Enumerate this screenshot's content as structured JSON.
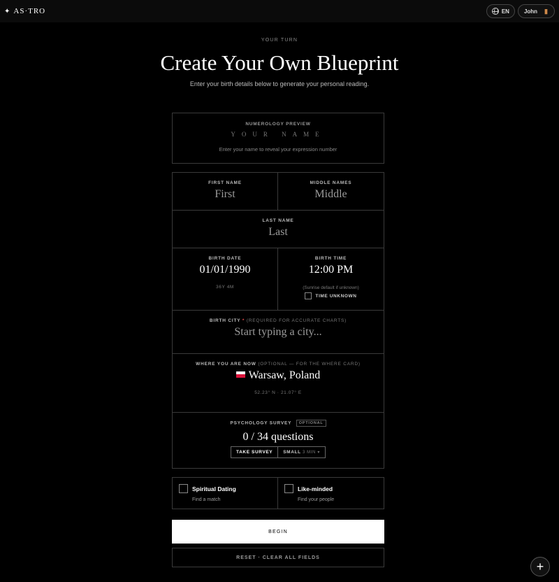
{
  "header": {
    "logo": "AS·TRO",
    "language": "EN",
    "user": "John"
  },
  "hero": {
    "eyebrow": "YOUR TURN",
    "title": "Create Your Own Blueprint",
    "subtitle": "Enter your birth details below to generate your personal reading."
  },
  "preview": {
    "label": "NUMEROLOGY PREVIEW",
    "name_placeholder": "YOUR NAME",
    "hint": "Enter your name to reveal your expression number"
  },
  "form": {
    "first_name": {
      "label": "FIRST NAME",
      "placeholder": "First"
    },
    "middle_names": {
      "label": "MIDDLE NAMES",
      "placeholder": "Middle"
    },
    "last_name": {
      "label": "LAST NAME",
      "placeholder": "Last"
    },
    "birth_date": {
      "label": "BIRTH DATE",
      "value": "01/01/1990",
      "age": "36Y 4M"
    },
    "birth_time": {
      "label": "BIRTH TIME",
      "value": "12:00 PM",
      "hint": "(Sunrise default if unknown)",
      "unknown_label": "TIME UNKNOWN"
    },
    "birth_city": {
      "label": "BIRTH CITY",
      "required_mark": "*",
      "note": "(REQUIRED FOR ACCURATE CHARTS)",
      "placeholder": "Start typing a city..."
    },
    "current_location": {
      "label": "WHERE YOU ARE NOW",
      "note": "(OPTIONAL — FOR THE WHERE CARD)",
      "value": "Warsaw, Poland",
      "coords": "52.23° N · 21.07° E"
    },
    "survey": {
      "label": "PSYCHOLOGY SURVEY",
      "badge": "OPTIONAL",
      "progress": "0 / 34 questions",
      "take_label": "TAKE SURVEY",
      "size_label": "SMALL",
      "size_time": "3 MIN"
    }
  },
  "prefs": {
    "spiritual": {
      "title": "Spiritual Dating",
      "subtitle": "Find a match"
    },
    "likeminded": {
      "title": "Like-minded",
      "subtitle": "Find your people"
    }
  },
  "actions": {
    "begin": "BEGIN",
    "reset": "RESET · CLEAR ALL FIELDS",
    "fab": "+"
  }
}
